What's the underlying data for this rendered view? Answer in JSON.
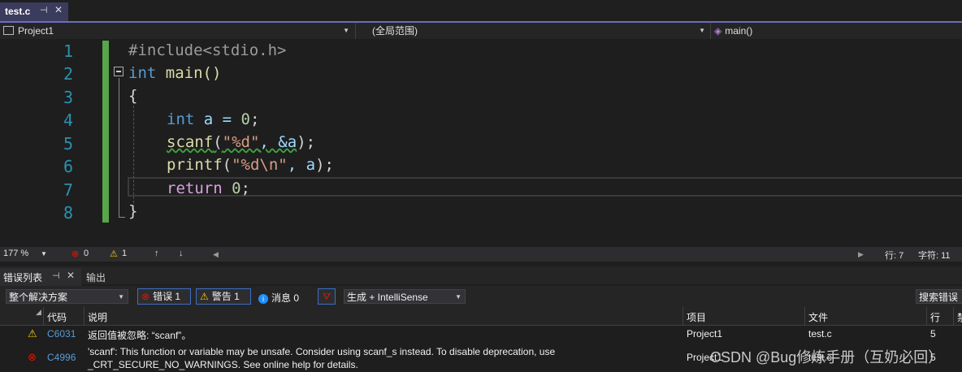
{
  "tab": {
    "title": "test.c",
    "pin": "⊣",
    "close": "✕"
  },
  "nav": {
    "project": "Project1",
    "scope": "(全局范围)",
    "func": "main()"
  },
  "editor": {
    "line_numbers": [
      "1",
      "2",
      "3",
      "4",
      "5",
      "6",
      "7",
      "8"
    ],
    "lines": {
      "l1": "#include<stdio.h>",
      "l2_kw": "int",
      "l2_rest": " main()",
      "l3": "{",
      "l4_kw": "int",
      "l4_rest": " a = ",
      "l4_num": "0",
      "l4_end": ";",
      "l5_fn": "scanf",
      "l5_open": "(",
      "l5_str": "\"%d\"",
      "l5_rest": ", &a",
      "l5_end": ");",
      "l6_fn": "printf",
      "l6_open": "(",
      "l6_str": "\"%d\\n\"",
      "l6_rest": ", a",
      "l6_end": ");",
      "l7_kw": "return",
      "l7_sp": " ",
      "l7_num": "0",
      "l7_end": ";",
      "l8": "}"
    }
  },
  "status": {
    "zoom": "177 %",
    "errors": "0",
    "warnings": "1",
    "line": "行: 7",
    "col": "字符: 11"
  },
  "panel": {
    "tab_errors": "错误列表",
    "tab_output": "输出",
    "scope_combo": "整个解决方案",
    "btn_errors": "错误 1",
    "btn_warnings": "警告 1",
    "btn_messages": "消息 0",
    "build_combo": "生成 + IntelliSense",
    "search": "搜索错误列表",
    "columns": {
      "code": "代码",
      "desc": "说明",
      "project": "项目",
      "file": "文件",
      "line": "行",
      "extra": "禁"
    },
    "rows": [
      {
        "code": "C6031",
        "desc": "返回值被忽略: “scanf”。",
        "desc2": "",
        "project": "Project1",
        "file": "test.c",
        "line": "5"
      },
      {
        "code": "C4996",
        "desc": "'scanf': This function or variable may be unsafe. Consider using scanf_s instead. To disable deprecation, use",
        "desc2": "_CRT_SECURE_NO_WARNINGS. See online help for details.",
        "project": "Project1",
        "file": "test.c",
        "line": "5"
      }
    ]
  },
  "watermark": "CSDN @Bug修炼手册（互奶必回）",
  "colors": {
    "keyword": "#569cd6",
    "string": "#d69d85",
    "number": "#b5cea8",
    "function": "#dcdcaa",
    "preprocessor": "#9b9b9b",
    "accent": "#007acc"
  }
}
